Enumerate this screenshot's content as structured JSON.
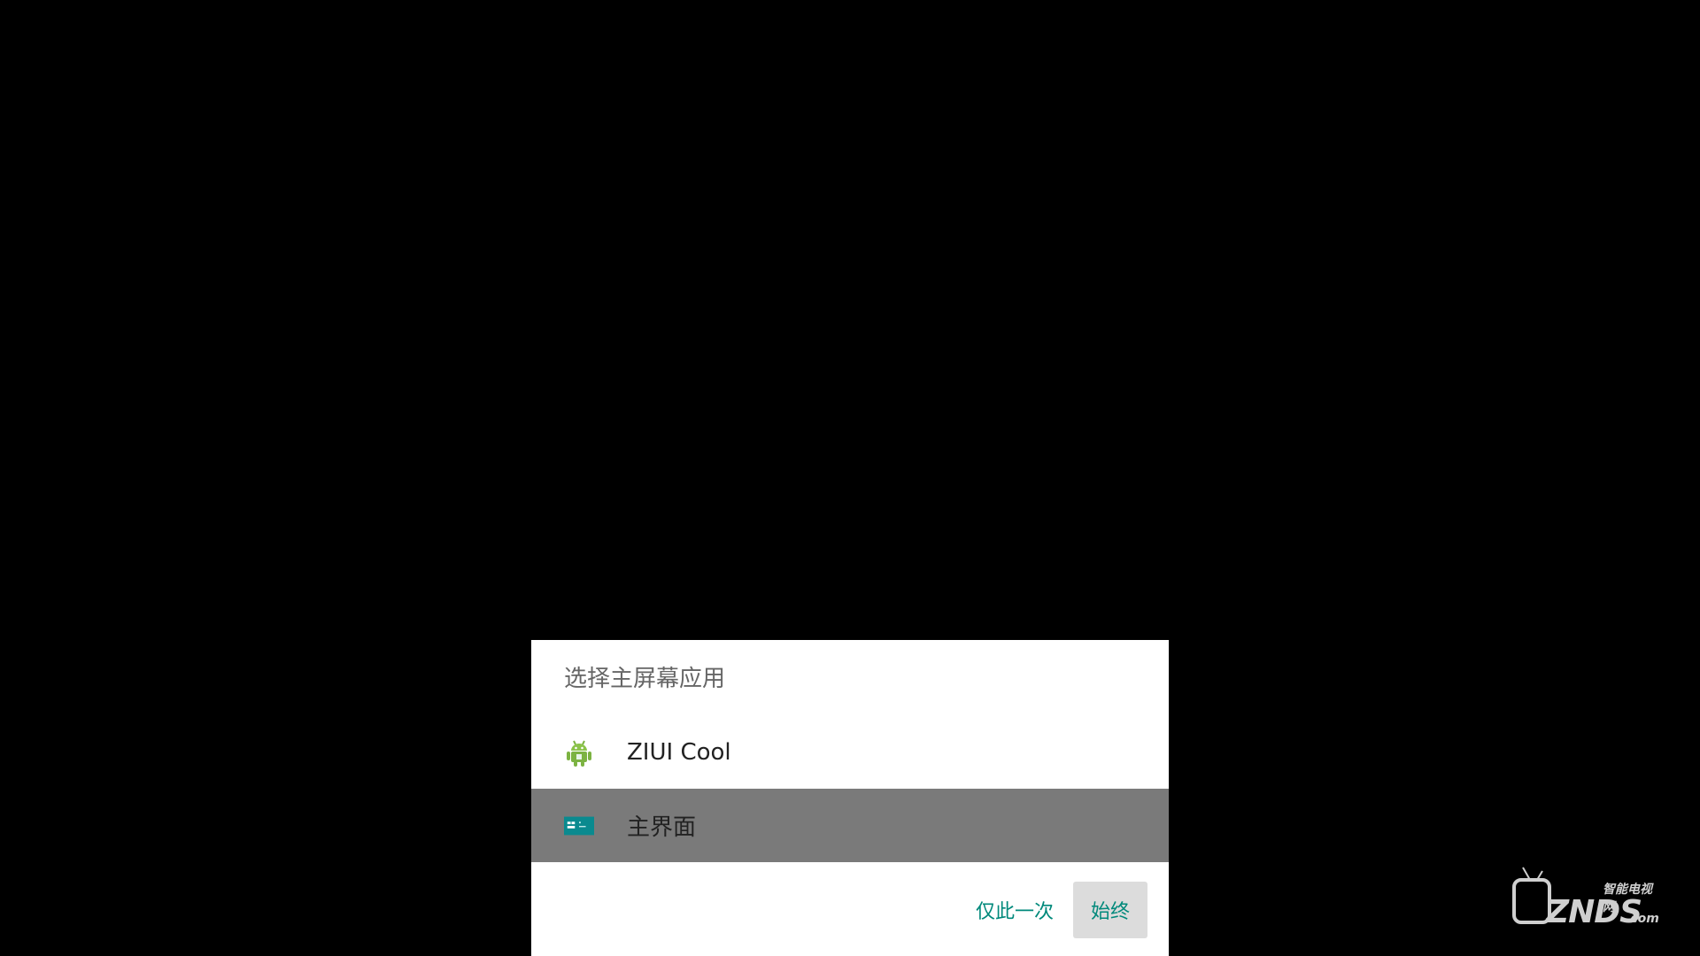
{
  "dialog": {
    "title": "选择主屏幕应用",
    "apps": [
      {
        "label": "ZIUI Cool",
        "icon": "android-robot-icon"
      },
      {
        "label": "主界面",
        "icon": "launcher-icon",
        "selected": true
      }
    ],
    "buttons": {
      "once": "仅此一次",
      "always": "始终"
    }
  },
  "watermark": {
    "small": "智能电视网",
    "big": "ZNDS",
    "suffix": ".com"
  },
  "colors": {
    "accent": "#00897b",
    "selected_row": "#7a7a7a",
    "background": "#000000"
  }
}
